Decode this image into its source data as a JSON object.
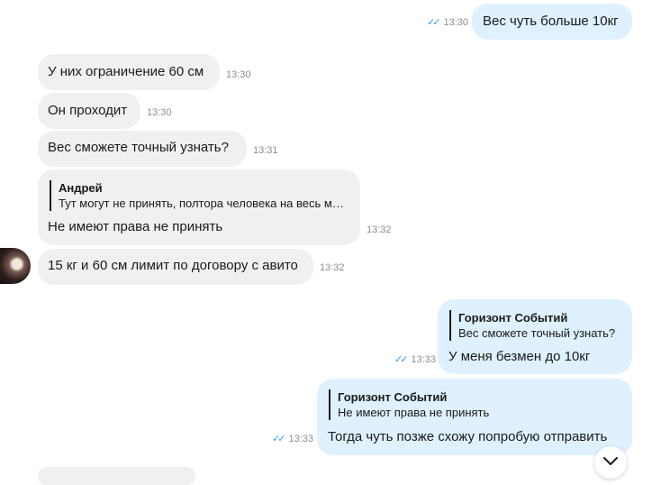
{
  "messages": [
    {
      "text": "Вес чуть больше 10кг",
      "time": "13:30",
      "read_ticks": "✓✓"
    },
    {
      "text": "У них ограничение 60 см",
      "time": "13:30"
    },
    {
      "text": "Он проходит",
      "time": "13:30"
    },
    {
      "text": "Вес сможете точный узнать?",
      "time": "13:31"
    },
    {
      "reply_author": "Андрей",
      "reply_text": "Тут могут не принять, полтора человека на весь м…",
      "text": "Не имеют права не принять",
      "time": "13:32"
    },
    {
      "text": "15 кг и 60 см лимит по договору с авито",
      "time": "13:32"
    },
    {
      "reply_author": "Горизонт Событий",
      "reply_text": "Вес сможете точный узнать?",
      "text": "У меня безмен до 10кг",
      "time": "13:33",
      "read_ticks": "✓✓"
    },
    {
      "reply_author": "Горизонт Событий",
      "reply_text": "Не имеют права не принять",
      "text": "Тогда чуть позже схожу попробую отправить",
      "time": "13:33",
      "read_ticks": "✓✓"
    }
  ],
  "colors": {
    "incoming_bubble": "#f0f0f0",
    "outgoing_bubble": "#dff1fe",
    "read_ticks": "#2e9cf0",
    "timestamp": "#8a8f95"
  },
  "icons": {
    "scroll_down": "chevron-down-icon",
    "read_status": "double-check-icon"
  }
}
